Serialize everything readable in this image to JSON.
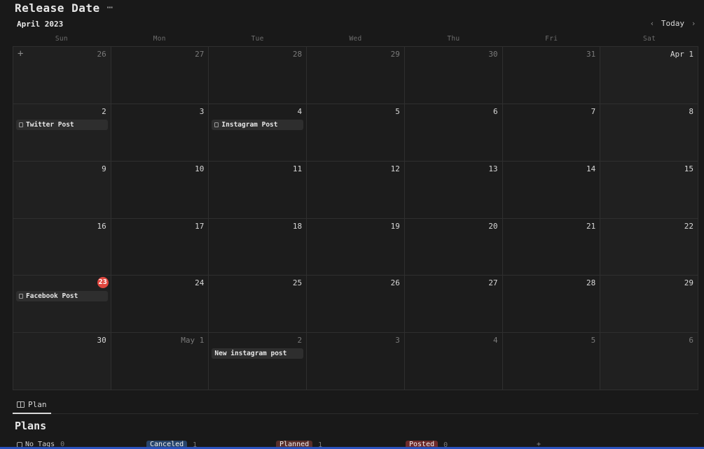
{
  "header": {
    "title": "Release Date",
    "more": "⋯"
  },
  "calendar": {
    "month": "April 2023",
    "today_label": "Today",
    "prev": "‹",
    "next": "›",
    "weekdays": [
      "Sun",
      "Mon",
      "Tue",
      "Wed",
      "Thu",
      "Fri",
      "Sat"
    ],
    "add": "+",
    "days": [
      "26",
      "27",
      "28",
      "29",
      "30",
      "31",
      "Apr 1",
      "2",
      "3",
      "4",
      "5",
      "6",
      "7",
      "8",
      "9",
      "10",
      "11",
      "12",
      "13",
      "14",
      "15",
      "16",
      "17",
      "18",
      "19",
      "20",
      "21",
      "22",
      "23",
      "24",
      "25",
      "26",
      "27",
      "28",
      "29",
      "30",
      "May 1",
      "2",
      "3",
      "4",
      "5",
      "6"
    ],
    "events": {
      "twitter": "Twitter Post",
      "instagram": "Instagram Post",
      "facebook": "Facebook Post",
      "new_instagram": "New instagram post"
    }
  },
  "tabs": {
    "plan": "Plan"
  },
  "plans": {
    "title": "Plans",
    "groups": [
      {
        "label": "No Tags",
        "count": "0"
      },
      {
        "label": "Canceled",
        "count": "1",
        "color": "#28456c"
      },
      {
        "label": "Planned",
        "count": "1",
        "color": "#5a2f2a"
      },
      {
        "label": "Posted",
        "count": "0",
        "color": "#6e2b2b"
      }
    ],
    "add": "+"
  }
}
